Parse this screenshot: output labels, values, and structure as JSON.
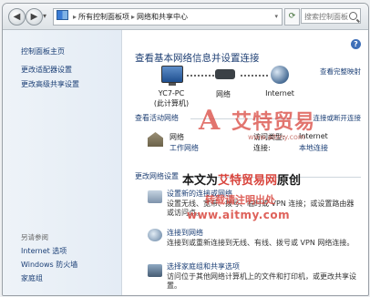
{
  "address_bar": {
    "crumbs": [
      "所有控制面板项",
      "网络和共享中心"
    ],
    "search_placeholder": "搜索控制面板"
  },
  "sidebar": {
    "items": [
      {
        "label": "控制面板主页"
      },
      {
        "label": "更改适配器设置"
      },
      {
        "label": "更改高级共享设置"
      }
    ],
    "see_also": {
      "heading": "另请参阅",
      "items": [
        {
          "label": "Internet 选项"
        },
        {
          "label": "Windows 防火墙"
        },
        {
          "label": "家庭组"
        }
      ]
    }
  },
  "main": {
    "help": "?",
    "title": "查看基本网络信息并设置连接",
    "full_map_link": "查看完整映射",
    "nodes": [
      {
        "label": "YC7-PC",
        "sub": "(此计算机)"
      },
      {
        "label": "网络"
      },
      {
        "label": "Internet"
      }
    ],
    "active_networks": {
      "title": "查看活动网络",
      "side_link": "连接或断开连接",
      "network_name": "网络",
      "network_type": "工作网络",
      "access_type_label": "访问类型:",
      "access_type_value": "Internet",
      "connection_label": "连接:",
      "connection_value": "本地连接"
    },
    "change_settings": {
      "title": "更改网络设置",
      "tasks": [
        {
          "title": "设置新的连接或网络",
          "desc": "设置无线、宽带、拨号、临时或 VPN 连接；或设置路由器或访问点。"
        },
        {
          "title": "连接到网络",
          "desc": "连接到或重新连接到无线、有线、拨号或 VPN 网络连接。"
        },
        {
          "title": "选择家庭组和共享选项",
          "desc": "访问位于其他网络计算机上的文件和打印机，或更改共享设置。"
        }
      ]
    }
  },
  "watermark": {
    "brand": "艾特贸易",
    "url_small": "www.aitmy.com",
    "line1_prefix": "本文为",
    "line1_brand": "艾特贸易网",
    "line1_suffix": "原创",
    "line2": "转载请注明出处",
    "url": "www.aitmy.com"
  }
}
